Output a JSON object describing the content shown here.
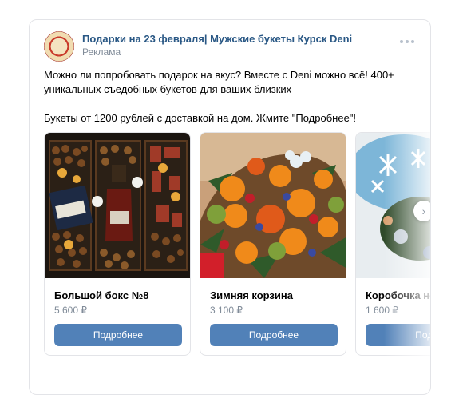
{
  "post": {
    "author": "Подарки на 23 февраля| Мужские букеты Курск Deni",
    "label": "Реклама",
    "text_line1": "Можно ли попробовать подарок на вкус? Вместе с Deni можно всё! 400+",
    "text_line2": "уникальных съедобных букетов для ваших близких",
    "text_line3": "Букеты от 1200 рублей с доставкой на дом. Жмите \"Подробнее\"!"
  },
  "carousel": {
    "cards": [
      {
        "title": "Большой бокс №8",
        "price": "5 600 ₽",
        "button": "Подробнее"
      },
      {
        "title": "Зимняя корзина",
        "price": "3 100 ₽",
        "button": "Подробнее"
      },
      {
        "title": "Коробочка нов",
        "price": "1 600 ₽",
        "button": "Подро"
      }
    ]
  },
  "icons": {
    "more": "more-horizontal-icon",
    "next": "chevron-right-icon"
  },
  "colors": {
    "link": "#2a5885",
    "button": "#5181b8",
    "muted": "#818c99"
  }
}
